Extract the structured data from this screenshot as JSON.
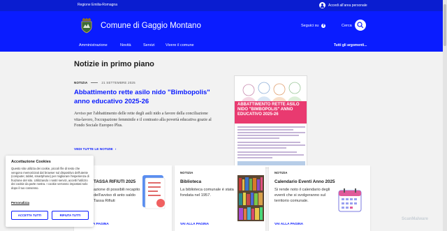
{
  "slim": {
    "region": "Regione Emilia-Romagna",
    "login": "Accedi all'area personale"
  },
  "header": {
    "title": "Comune di Gaggio Montano",
    "follow": "Seguici su",
    "search": "Cerca",
    "nav": [
      "Amministrazione",
      "Novità",
      "Servizi",
      "Vivere il comune"
    ],
    "all_topics": "Tutti gli argomenti..."
  },
  "highlight": {
    "section_title": "Notizie in primo piano",
    "kicker": "NOTIZIA",
    "date": "21 SETTEMBRE 2025",
    "title": "Abbattimento rette asilo nido \"Bimbopolis\" anno educativo 2025-26",
    "abstract": "Avviso per l'abbattimento delle rette degli asili nido a favore della conciliazione vita-lavoro, l'occupazione femminile e il contrasto alla povertà educativa grazie al Fondo Sociale Europeo Plus.",
    "see_all": "VEDI TUTTE LE NOTIZIE",
    "poster_band": "ABBATTIMENTO RETTE ASILO NIDO \"BIMBOPOLIS\" ANNO EDUCATIVO 2025-26"
  },
  "cards": [
    {
      "kicker": "",
      "title": "TASSA RIFIUTI 2025",
      "desc": "azione di possibili recapito dell'avviso di anto saldo Tassa Rifiuti",
      "link": "LA PAGINA"
    },
    {
      "kicker": "NOTIZIA",
      "title": "Biblioteca",
      "desc": "La biblioteca comunale è stata fondata nel 1957.",
      "link": "VAI ALLA PAGINA"
    },
    {
      "kicker": "NOTIZIA",
      "title": "Calendario Eventi Anno 2025",
      "desc": "Si rende noto il calendario degli eventi che si svolgeranno sul territorio comunale.",
      "link": "VAI ALLA PAGINA"
    }
  ],
  "cookie": {
    "title": "Accettazione Cookies",
    "text": "Questo sito utilizza dei cookie, piccoli file di testo che vengono memorizzati dal browser sul dispositivo dell'utente (computer, tablet, smartphone) per migliorare l'esperienza di fruizione del sito. Utilizzando i nostri servizi, accetti l'utilizzo dei cookie da parte nostra. I cookie verranno impostati solo dopo il tuo consenso.",
    "link": "Personalizza",
    "accept": "ACCETTA TUTTI",
    "reject": "RIFIUTA TUTTI"
  },
  "watermark": "ScanMalware",
  "colors": {
    "primary": "#0a1cff",
    "slim": "#0a1dd0",
    "poster_band": "#e93a70"
  }
}
